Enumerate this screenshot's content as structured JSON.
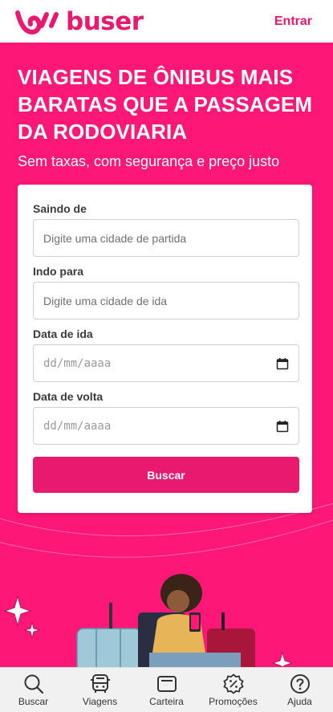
{
  "header": {
    "brand": "buser",
    "login_label": "Entrar"
  },
  "hero": {
    "title": "VIAGENS DE ÔNIBUS MAIS BARATAS QUE A PASSAGEM DA RODOVIARIA",
    "subtitle": "Sem taxas, com segurança e preço justo"
  },
  "form": {
    "from_label": "Saindo de",
    "from_placeholder": "Digite uma cidade de partida",
    "to_label": "Indo para",
    "to_placeholder": "Digite uma cidade de ida",
    "depart_label": "Data de ida",
    "depart_placeholder": "dd/mm/aaaa",
    "return_label": "Data de volta",
    "return_placeholder": "dd/mm/aaaa",
    "search_label": "Buscar"
  },
  "nav": {
    "items": [
      {
        "label": "Buscar",
        "icon": "search-icon"
      },
      {
        "label": "Viagens",
        "icon": "bus-icon"
      },
      {
        "label": "Carteira",
        "icon": "wallet-icon"
      },
      {
        "label": "Promoções",
        "icon": "discount-icon"
      },
      {
        "label": "Ajuda",
        "icon": "help-icon"
      }
    ]
  },
  "colors": {
    "brand": "#e8196e",
    "hero_bg": "#fd1877"
  }
}
